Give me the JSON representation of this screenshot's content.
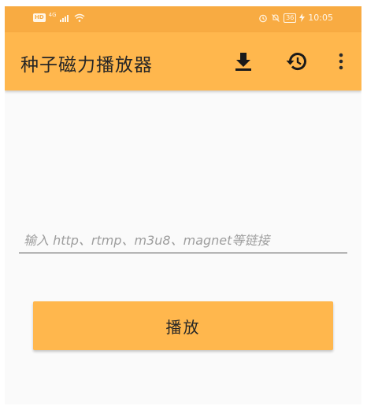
{
  "status_bar": {
    "hd_badge": "HD",
    "network_type": "4G",
    "battery_level": "36",
    "time": "10:05",
    "icons": [
      "signal-icon",
      "wifi-icon",
      "alarm-icon",
      "mute-icon",
      "battery-icon",
      "charging-icon"
    ]
  },
  "toolbar": {
    "title": "种子磁力播放器",
    "icons": [
      "download-icon",
      "history-icon",
      "more-vert-icon"
    ]
  },
  "main": {
    "url_input": {
      "value": "",
      "placeholder": "输入 http、rtmp、m3u8、magnet等链接"
    },
    "play_button_label": "播放"
  },
  "colors": {
    "status_bar_bg": "#f8ab42",
    "toolbar_bg": "#ffb74d",
    "button_bg": "#ffb74d",
    "page_bg": "#fafafa"
  }
}
